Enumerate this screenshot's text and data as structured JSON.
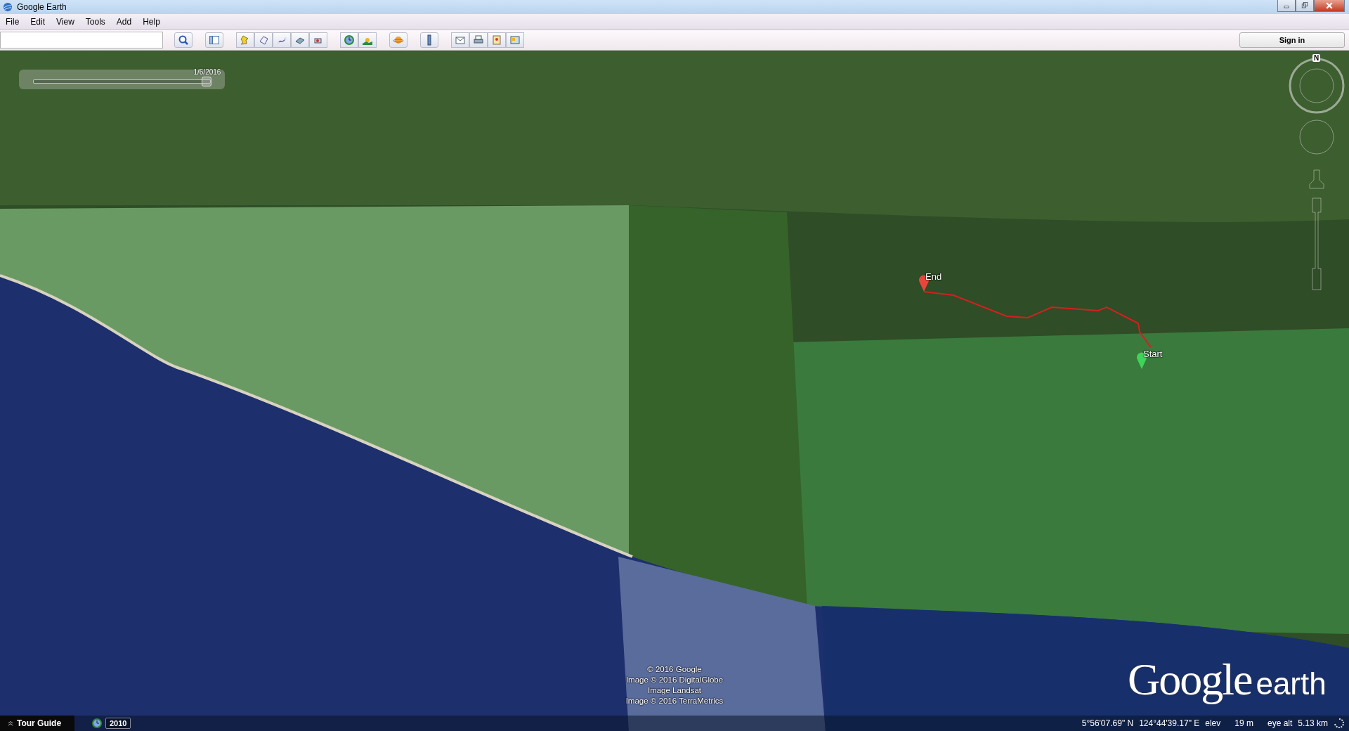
{
  "window": {
    "title": "Google Earth"
  },
  "menu": [
    "File",
    "Edit",
    "View",
    "Tools",
    "Add",
    "Help"
  ],
  "toolbar": {
    "sign_in": "Sign in"
  },
  "time_slider": {
    "date": "1/6/2016",
    "level": 0.98
  },
  "compass": {
    "north": "N"
  },
  "placemarks": [
    {
      "label": "End",
      "color": "#e8453c"
    },
    {
      "label": "Start",
      "color": "#3fd35a"
    }
  ],
  "attribution": [
    "© 2016 Google",
    "Image © 2016 DigitalGlobe",
    "Image Landsat",
    "Image © 2016 TerraMetrics"
  ],
  "logo": {
    "brand": "Google",
    "product": "earth"
  },
  "status_bar": {
    "tour_guide": "Tour Guide",
    "historical_year": "2010",
    "latitude": "5°56'07.69\" N",
    "longitude": "124°44'39.17\" E",
    "elev_label": "elev",
    "elev": "19 m",
    "eye_alt_label": "eye alt",
    "eye_alt": "5.13 km"
  }
}
